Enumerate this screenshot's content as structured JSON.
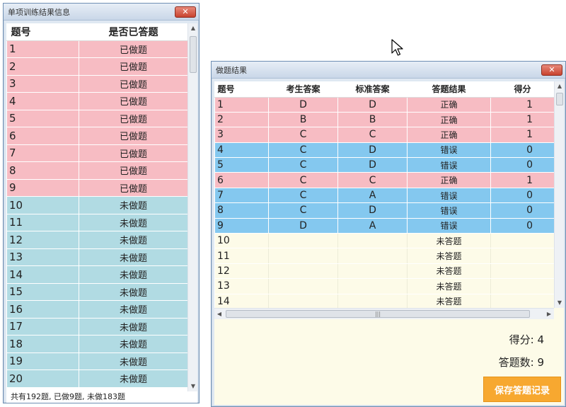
{
  "left_window": {
    "title": "单项训练结果信息",
    "columns": [
      "题号",
      "是否已答题"
    ],
    "rows": [
      {
        "num": "1",
        "status": "已做题",
        "done": true
      },
      {
        "num": "2",
        "status": "已做题",
        "done": true
      },
      {
        "num": "3",
        "status": "已做题",
        "done": true
      },
      {
        "num": "4",
        "status": "已做题",
        "done": true
      },
      {
        "num": "5",
        "status": "已做题",
        "done": true
      },
      {
        "num": "6",
        "status": "已做题",
        "done": true
      },
      {
        "num": "7",
        "status": "已做题",
        "done": true
      },
      {
        "num": "8",
        "status": "已做题",
        "done": true
      },
      {
        "num": "9",
        "status": "已做题",
        "done": true
      },
      {
        "num": "10",
        "status": "未做题",
        "done": false
      },
      {
        "num": "11",
        "status": "未做题",
        "done": false
      },
      {
        "num": "12",
        "status": "未做题",
        "done": false
      },
      {
        "num": "13",
        "status": "未做题",
        "done": false
      },
      {
        "num": "14",
        "status": "未做题",
        "done": false
      },
      {
        "num": "15",
        "status": "未做题",
        "done": false
      },
      {
        "num": "16",
        "status": "未做题",
        "done": false
      },
      {
        "num": "17",
        "status": "未做题",
        "done": false
      },
      {
        "num": "18",
        "status": "未做题",
        "done": false
      },
      {
        "num": "19",
        "status": "未做题",
        "done": false
      },
      {
        "num": "20",
        "status": "未做题",
        "done": false
      }
    ],
    "status_text": "共有192题, 已做9题, 未做183题"
  },
  "right_window": {
    "title": "做题结果",
    "columns": [
      "题号",
      "考生答案",
      "标准答案",
      "答题结果",
      "得分"
    ],
    "rows": [
      {
        "num": "1",
        "answer": "D",
        "standard": "D",
        "result": "正确",
        "score": "1",
        "state": "correct"
      },
      {
        "num": "2",
        "answer": "B",
        "standard": "B",
        "result": "正确",
        "score": "1",
        "state": "correct"
      },
      {
        "num": "3",
        "answer": "C",
        "standard": "C",
        "result": "正确",
        "score": "1",
        "state": "correct"
      },
      {
        "num": "4",
        "answer": "C",
        "standard": "D",
        "result": "错误",
        "score": "0",
        "state": "wrong"
      },
      {
        "num": "5",
        "answer": "C",
        "standard": "D",
        "result": "错误",
        "score": "0",
        "state": "wrong"
      },
      {
        "num": "6",
        "answer": "C",
        "standard": "C",
        "result": "正确",
        "score": "1",
        "state": "correct"
      },
      {
        "num": "7",
        "answer": "C",
        "standard": "A",
        "result": "错误",
        "score": "0",
        "state": "wrong"
      },
      {
        "num": "8",
        "answer": "C",
        "standard": "D",
        "result": "错误",
        "score": "0",
        "state": "wrong"
      },
      {
        "num": "9",
        "answer": "D",
        "standard": "A",
        "result": "错误",
        "score": "0",
        "state": "wrong"
      },
      {
        "num": "10",
        "answer": "",
        "standard": "",
        "result": "未答题",
        "score": "",
        "state": "none"
      },
      {
        "num": "11",
        "answer": "",
        "standard": "",
        "result": "未答题",
        "score": "",
        "state": "none"
      },
      {
        "num": "12",
        "answer": "",
        "standard": "",
        "result": "未答题",
        "score": "",
        "state": "none"
      },
      {
        "num": "13",
        "answer": "",
        "standard": "",
        "result": "未答题",
        "score": "",
        "state": "none"
      },
      {
        "num": "14",
        "answer": "",
        "standard": "",
        "result": "未答题",
        "score": "",
        "state": "none"
      }
    ],
    "score_label": "得分:",
    "score_value": "4",
    "answered_label": "答题数:",
    "answered_value": "9",
    "save_button": "保存答题记录"
  },
  "window_controls": {
    "close_glyph": "✕"
  },
  "colors": {
    "done_row": "#f7bcc3",
    "todo_row": "#b1dbe3",
    "wrong_row": "#84c8ef",
    "unanswered_row": "#fdfbe8",
    "save_button": "#f7a830"
  },
  "icons": [
    "close-icon",
    "cursor-arrow-icon",
    "scroll-up-icon",
    "scroll-down-icon",
    "scroll-left-icon",
    "scroll-right-icon"
  ]
}
